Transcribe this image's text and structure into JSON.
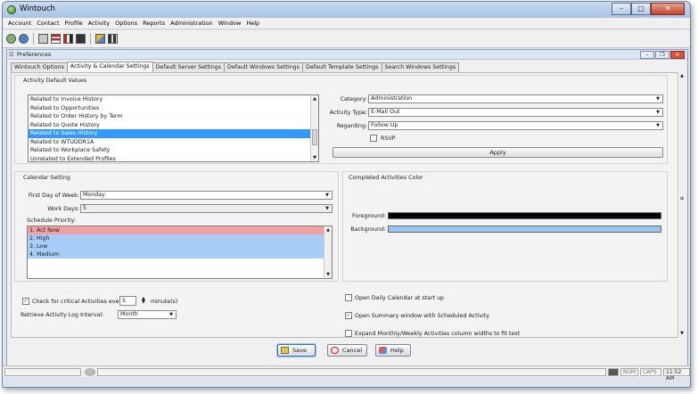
{
  "window": {
    "title": "Wintouch",
    "minimize": "–",
    "maximize": "□",
    "close": "✕"
  },
  "menu": [
    "Account",
    "Contact",
    "Profile",
    "Activity",
    "Options",
    "Reports",
    "Administration",
    "Window",
    "Help"
  ],
  "inner": {
    "title": "Preferences",
    "minimize": "–",
    "restore": "❐",
    "close": "✕"
  },
  "tabs": [
    "Wintouch Options",
    "Activity & Calendar Settings",
    "Default Server Settings",
    "Default Windows Settings",
    "Default Template Settings",
    "Search Windows Settings"
  ],
  "activity_defaults": {
    "group_label": "Activity Default Values",
    "list": [
      "Related to Invoice History",
      "Related to Opportunities",
      "Related to Order History by Term",
      "Related to Quote History",
      "Related to Sales History",
      "Related to WTUDDR1A",
      "Related to Workplace Safety",
      "Unrelated to Extended Profiles"
    ],
    "category_label": "Category:",
    "category_value": "Administration",
    "activity_type_label": "Activity Type:",
    "activity_type_value": "E-Mail Out",
    "regarding_label": "Regarding:",
    "regarding_value": "Follow Up",
    "rsvp_label": "RSVP",
    "apply_label": "Apply"
  },
  "calendar": {
    "group_label": "Calendar Setting",
    "first_day_label": "First Day of Week:",
    "first_day_value": "Monday",
    "work_days_label": "Work Days:",
    "work_days_value": "5",
    "priority_label": "Schedule Priority:",
    "priorities": [
      "1. Act Now",
      "2. High",
      "3. Low",
      "4. Medium"
    ],
    "priority_colors": [
      "#f2a0a4",
      "#a8cdf8",
      "#a8cdf8",
      "#a8cdf8"
    ]
  },
  "completed_colors": {
    "group_label": "Completed Activities Color",
    "foreground_label": "Foreground:",
    "foreground_color": "#000000",
    "background_label": "Background:",
    "background_color": "#99c6f0"
  },
  "options": {
    "critical_label": "Check for critical Activities every",
    "critical_value": "5",
    "critical_unit": "minute(s)",
    "log_interval_label": "Retrieve Activity Log Interval:",
    "log_interval_value": "Month",
    "open_daily_label": "Open Daily Calendar at start up",
    "open_summary_label": "Open Summary window with Scheduled Activity",
    "expand_label": "Expand Monthly/Weekly Activities column widths to fit text"
  },
  "buttons": {
    "save": "Save",
    "cancel": "Cancel",
    "help": "Help"
  },
  "status": {
    "num": "NUM",
    "caps": "CAPS",
    "time": "11:52 AM"
  }
}
